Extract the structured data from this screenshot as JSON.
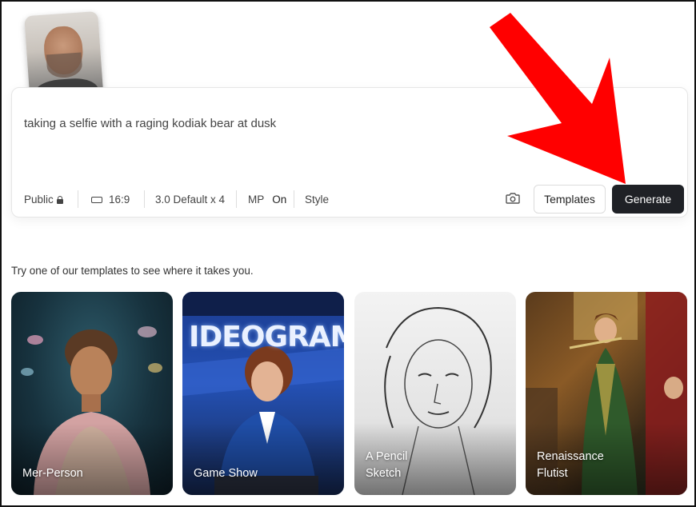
{
  "prompt": {
    "text": "taking a selfie with a raging kodiak bear at dusk"
  },
  "toolbar": {
    "visibility_label": "Public",
    "aspect_ratio": "16:9",
    "model_label": "3.0 Default x 4",
    "magic_prompt_label": "MP",
    "magic_prompt_value": "On",
    "style_label": "Style",
    "templates_button": "Templates",
    "generate_button": "Generate"
  },
  "templates": {
    "caption": "Try one of our templates to see where it takes you.",
    "cards": [
      {
        "label": "Mer-Person"
      },
      {
        "label": "Game Show",
        "image_text": "IDEOGRAM"
      },
      {
        "label": "A Pencil\nSketch"
      },
      {
        "label": "Renaissance\nFlutist"
      }
    ]
  },
  "icons": {
    "visibility": "lock-icon",
    "aspect": "aspect-ratio-icon",
    "upload": "camera-icon"
  },
  "colors": {
    "generate_bg": "#1f2126",
    "annotation_arrow": "#ff0000"
  }
}
